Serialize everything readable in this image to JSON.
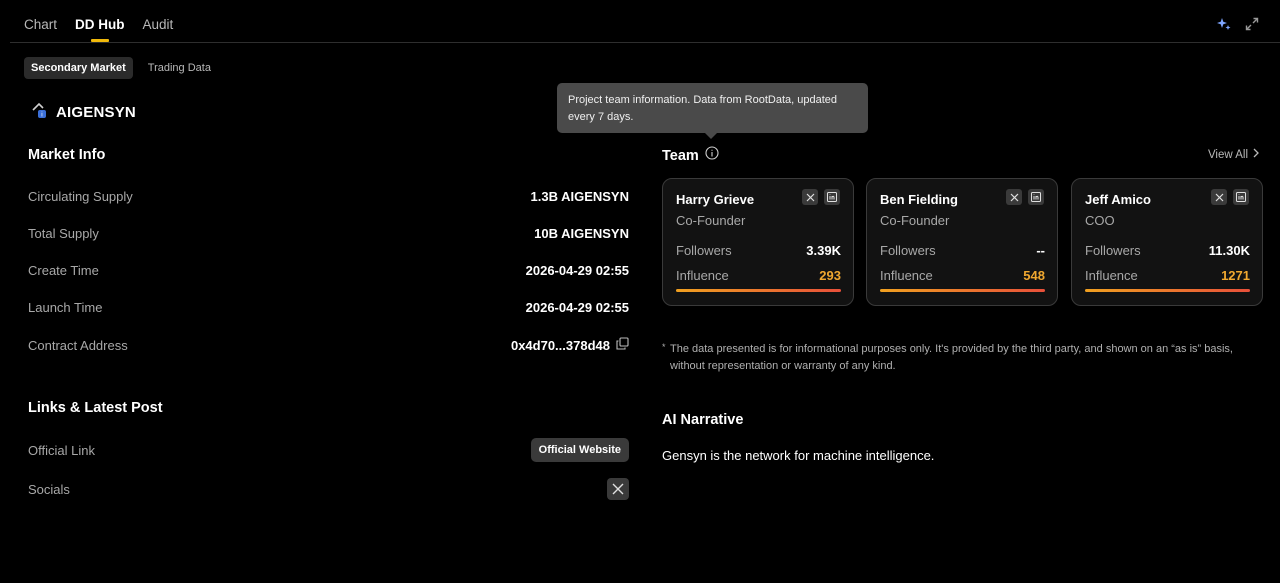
{
  "tabs": [
    "Chart",
    "DD Hub",
    "Audit"
  ],
  "subtabs": [
    "Secondary Market",
    "Trading Data"
  ],
  "token": {
    "name": "AIGENSYN"
  },
  "market_info": {
    "title": "Market Info",
    "rows": [
      {
        "label": "Circulating Supply",
        "value": "1.3B AIGENSYN"
      },
      {
        "label": "Total Supply",
        "value": "10B AIGENSYN"
      },
      {
        "label": "Create Time",
        "value": "2026-04-29 02:55"
      },
      {
        "label": "Launch Time",
        "value": "2026-04-29 02:55"
      },
      {
        "label": "Contract Address",
        "value": "0x4d70...378d48"
      }
    ]
  },
  "links": {
    "title": "Links & Latest Post",
    "official_label": "Official Link",
    "official_button": "Official Website",
    "socials_label": "Socials"
  },
  "tooltip": "Project team information. Data from RootData, updated every 7 days.",
  "team": {
    "title": "Team",
    "view_all": "View All",
    "followers_label": "Followers",
    "influence_label": "Influence",
    "members": [
      {
        "name": "Harry Grieve",
        "role": "Co-Founder",
        "followers": "3.39K",
        "influence": "293"
      },
      {
        "name": "Ben Fielding",
        "role": "Co-Founder",
        "followers": "--",
        "influence": "548"
      },
      {
        "name": "Jeff Amico",
        "role": "COO",
        "followers": "11.30K",
        "influence": "1271"
      }
    ]
  },
  "disclaimer": {
    "asterisk": "*",
    "text": "The data presented is for informational purposes only. It's provided by the third party, and shown on an “as is” basis, without representation or warranty of any kind."
  },
  "ai_narrative": {
    "title": "AI Narrative",
    "text": "Gensyn is the network for machine intelligence."
  },
  "colors": {
    "accent": "#f0b90b",
    "influence": "#f0a830",
    "background": "#000000"
  },
  "icons": [
    "ai-sparkle-icon",
    "expand-icon",
    "token-logo-icon",
    "info-icon",
    "chevron-right-icon",
    "x-icon",
    "linkedin-icon",
    "copy-icon"
  ]
}
